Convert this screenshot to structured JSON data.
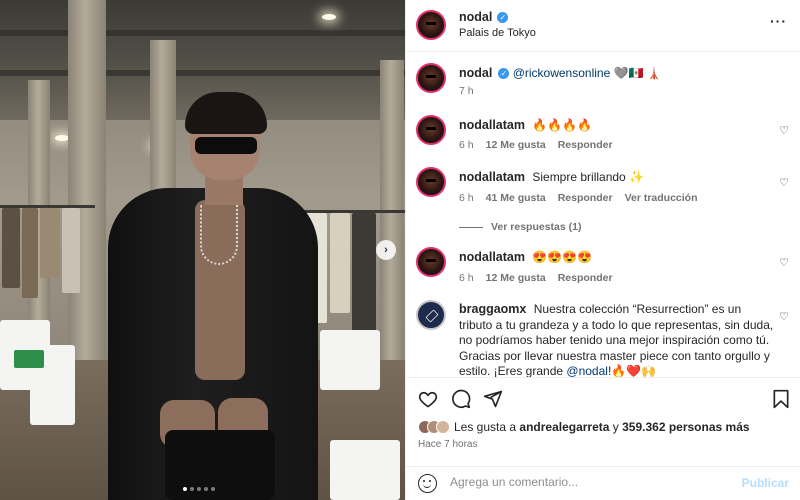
{
  "post": {
    "author": "nodal",
    "location": "Palais de Tokyo",
    "caption_mention": "@rickowensonline",
    "caption_emojis": "🩶🇲🇽 🗼",
    "caption_time": "7 h",
    "carousel_dots": 5,
    "active_dot": 0
  },
  "comments": [
    {
      "user": "nodallatam",
      "text": "🔥🔥🔥🔥",
      "time": "6 h",
      "likes": "12 Me gusta",
      "reply": "Responder",
      "translate": ""
    },
    {
      "user": "nodallatam",
      "text": "Siempre brillando ✨",
      "time": "6 h",
      "likes": "41 Me gusta",
      "reply": "Responder",
      "translate": "Ver traducción"
    },
    {
      "user": "nodallatam",
      "text": "😍😍😍😍",
      "time": "6 h",
      "likes": "12 Me gusta",
      "reply": "Responder",
      "translate": ""
    },
    {
      "user": "braggaomx",
      "text": "Nuestra colección “Resurrection” es un tributo a tu grandeza y a todo lo que representas, sin duda, no podríamos haber tenido una mejor inspiración como tú. Gracias por llevar nuestra master piece con tanto orgullo y estilo. ¡Eres grande",
      "mention": "@nodal",
      "tail": "!🔥❤️🙌"
    }
  ],
  "view_replies": "Ver respuestas (1)",
  "likes": {
    "prefix": "Les gusta a",
    "user": "andrealegarreta",
    "joiner": "y",
    "count": "359.362 personas más"
  },
  "time_ago": "Hace 7 horas",
  "comment_box": {
    "placeholder": "Agrega un comentario...",
    "publish": "Publicar"
  },
  "icons": [
    "heart-icon",
    "comment-icon",
    "share-icon",
    "bookmark-icon",
    "emoji-icon",
    "more-icon",
    "verified-icon",
    "chevron-right-icon"
  ],
  "colors": {
    "link": "#00376b",
    "verified": "#3897f0",
    "publish_disabled": "#b2dffc",
    "muted": "#737373"
  }
}
